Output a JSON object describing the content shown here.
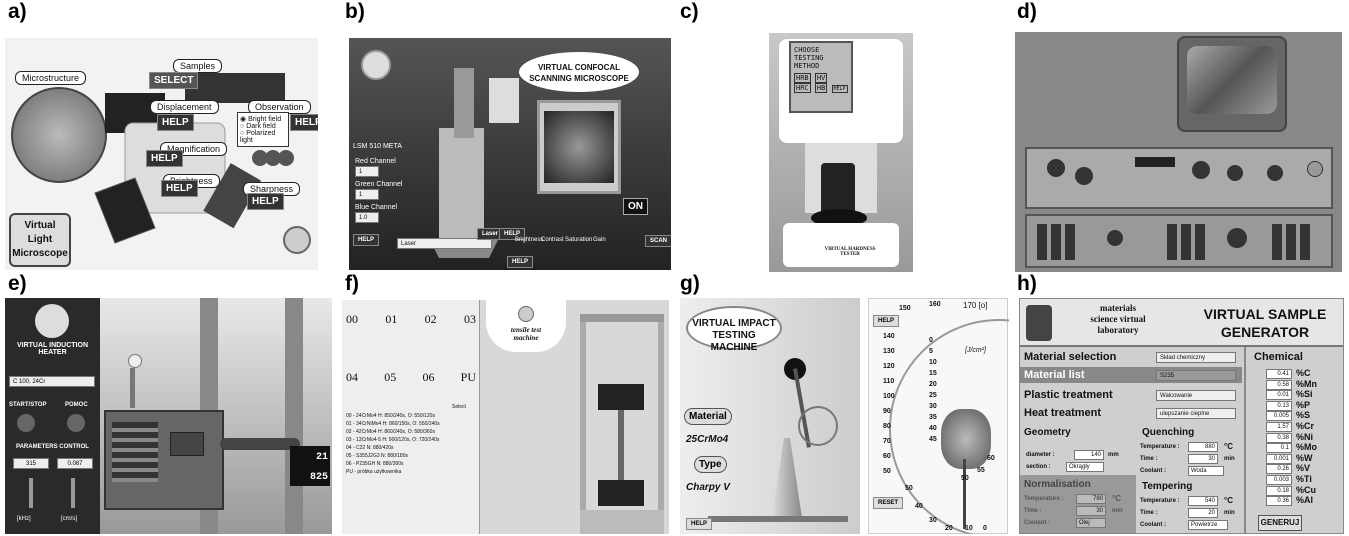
{
  "panels": {
    "a": "a)",
    "b": "b)",
    "c": "c)",
    "d": "d)",
    "e": "e)",
    "f": "f)",
    "g": "g)",
    "h": "h)"
  },
  "a": {
    "microstructure": "Microstructure",
    "samples": "Samples",
    "select": "SELECT",
    "displacement": "Displacement",
    "observation": "Observation",
    "help": "HELP",
    "bright_field": "Bright field",
    "dark_field": "Dark field",
    "polarized": "Polarized light",
    "magnification": "Magnification",
    "brightness": "Brightness",
    "sharpness": "Sharpness",
    "title_l1": "Virtual",
    "title_l2": "Light",
    "title_l3": "Microscope"
  },
  "b": {
    "title_l1": "VIRTUAL CONFOCAL",
    "title_l2": "SCANNING MICROSCOPE",
    "on": "ON",
    "help": "HELP",
    "laser": "Laser",
    "model": "LSM 510 META",
    "ch1": "Red Channel",
    "ch2": "Green Channel",
    "ch3": "Blue Channel",
    "brightness": "Brightness",
    "contrast": "Contrast",
    "saturation": "Saturation",
    "gain": "Gain",
    "scan": "SCAN"
  },
  "c": {
    "screen_l1": "CHOOSE TESTING",
    "screen_l2": "METHOD",
    "hrb": "HRB",
    "hv": "HV",
    "hrc": "HRC",
    "hb": "HB",
    "help": "HELP",
    "footer_l1": "VIRTUAL HARDNESS",
    "footer_l2": "TESTER"
  },
  "e": {
    "title_l1": "VIRTUAL INDUCTION",
    "title_l2": "HEATER",
    "material": "C 100, 24Cr",
    "startstop": "START/STOP",
    "pomoc": "POMOC",
    "params": "PARAMETERS CONTROL",
    "v1": "315",
    "v2": "0.087",
    "u1": "[kHz]",
    "u2": "[cm/s]",
    "r1": "21",
    "r2": "825"
  },
  "f": {
    "samples_row1": [
      "00",
      "01",
      "02",
      "03"
    ],
    "samples_row2": [
      "04",
      "05",
      "06",
      "PU"
    ],
    "title_l1": "tensile test",
    "title_l2": "machine",
    "select": "Select",
    "list": [
      "00 - 24CrMo4 H: 850/240s, O: 550/120s",
      "01 - 34CrNiMo4 H: 860/150s, O: 550/240s",
      "02 - 42CrMo4 H: 860/240s, O: 580/360s",
      "03 - 13CrMo4-5 H: 900/120s, O: 720/240s",
      "04 - C22 N: 880/420s",
      "05 - S355J2G3 N: 880/180s",
      "06 - P235GH N: 880/300s",
      "PU - próbka użytkownika"
    ]
  },
  "g": {
    "title_l1": "VIRTUAL IMPACT",
    "title_l2": "TESTING MACHINE",
    "material": "Material",
    "material_val": "25CrMo4",
    "type": "Type",
    "type_val": "Charpy V",
    "help": "HELP",
    "reset": "RESET",
    "units": "[J/cm²]",
    "scale_top": "170 [o]",
    "ticks": [
      "160",
      "150",
      "140",
      "130",
      "120",
      "110",
      "100",
      "90",
      "80",
      "70",
      "60",
      "50",
      "40",
      "30",
      "20",
      "10",
      "0"
    ],
    "inner_ticks": [
      "0",
      "5",
      "10",
      "15",
      "20",
      "25",
      "30",
      "35",
      "40",
      "45",
      "50",
      "55",
      "60"
    ]
  },
  "h": {
    "title_l1": "materials",
    "title_l2": "science virtual",
    "title_l3": "laboratory",
    "title_r1": "VIRTUAL SAMPLE",
    "title_r2": "GENERATOR",
    "material_selection": "Material selection",
    "material_selection_val": "Skład chemiczny",
    "material_list": "Material list",
    "material_list_val": "S235",
    "plastic": "Plastic treatment",
    "plastic_val": "Walcowanie",
    "heat": "Heat treatment",
    "heat_val": "ulepszanie cieplne",
    "geometry": "Geometry",
    "diameter": "diameter :",
    "diameter_val": "140",
    "mm": "mm",
    "section": "section :",
    "section_val": "Okrągły",
    "quenching": "Quenching",
    "temperature": "Temperature :",
    "q_temp": "880",
    "time": "Time :",
    "q_time": "30",
    "coolant": "Coolant :",
    "q_coolant": "Woda",
    "deg": "°C",
    "min": "min",
    "normalisation": "Normalisation",
    "n_temp": "780",
    "n_time": "30",
    "n_coolant": "Olej",
    "tempering": "Tempering",
    "t_temp": "540",
    "t_time": "20",
    "t_coolant": "Powietrze",
    "chemical": "Chemical",
    "button": "GENERUJ",
    "chem": [
      {
        "v": "0.41",
        "e": "%C"
      },
      {
        "v": "0.58",
        "e": "%Mn"
      },
      {
        "v": "0.01",
        "e": "%Si"
      },
      {
        "v": "0.13",
        "e": "%P"
      },
      {
        "v": "0.005",
        "e": "%S"
      },
      {
        "v": "1.57",
        "e": "%Cr"
      },
      {
        "v": "0.38",
        "e": "%Ni"
      },
      {
        "v": "0.1",
        "e": "%Mo"
      },
      {
        "v": "0.001",
        "e": "%W"
      },
      {
        "v": "0.26",
        "e": "%V"
      },
      {
        "v": "0.003",
        "e": "%Ti"
      },
      {
        "v": "0.18",
        "e": "%Cu"
      },
      {
        "v": "0.36",
        "e": "%Al"
      }
    ]
  }
}
